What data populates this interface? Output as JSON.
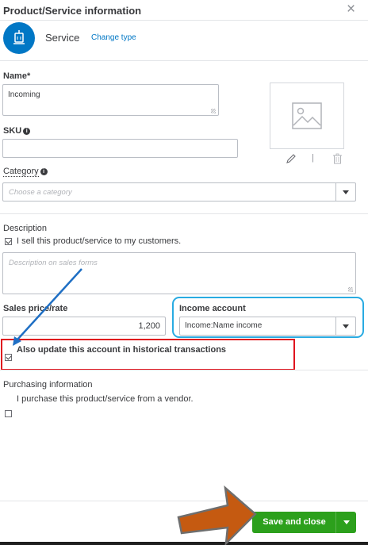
{
  "panel": {
    "title": "Product/Service information",
    "close_glyph": "×"
  },
  "item_type": {
    "label": "Service",
    "change_link": "Change type",
    "icon": "service-bell-icon",
    "icon_color": "#0077c5"
  },
  "name": {
    "label": "Name*",
    "value": "Incoming"
  },
  "sku": {
    "label": "SKU",
    "value": ""
  },
  "image": {
    "icon": "image-placeholder-icon",
    "edit_icon": "pencil-icon",
    "separator": "|",
    "delete_icon": "trash-icon"
  },
  "category": {
    "label": "Category",
    "placeholder": "Choose a category"
  },
  "description": {
    "label": "Description",
    "sell_checkbox_label": "I sell this product/service to my customers.",
    "sell_checked": true,
    "placeholder": "Description on sales forms"
  },
  "sales_price": {
    "label": "Sales price/rate",
    "value": "1,200"
  },
  "income_account": {
    "label": "Income account",
    "value": "Income:Name income"
  },
  "historical": {
    "label": "Also update this account in historical transactions",
    "checked": true
  },
  "purchasing": {
    "label": "Purchasing information",
    "checkbox_label": "I purchase this product/service from a vendor.",
    "checked": false
  },
  "footer": {
    "save_label": "Save and close",
    "save_color": "#2ca01c"
  },
  "annotations": {
    "red_box_color": "#e0141e",
    "cyan_box_color": "#29abe2",
    "arrow_blue": "#1f6fc4",
    "arrow_orange": "#c55a11"
  }
}
